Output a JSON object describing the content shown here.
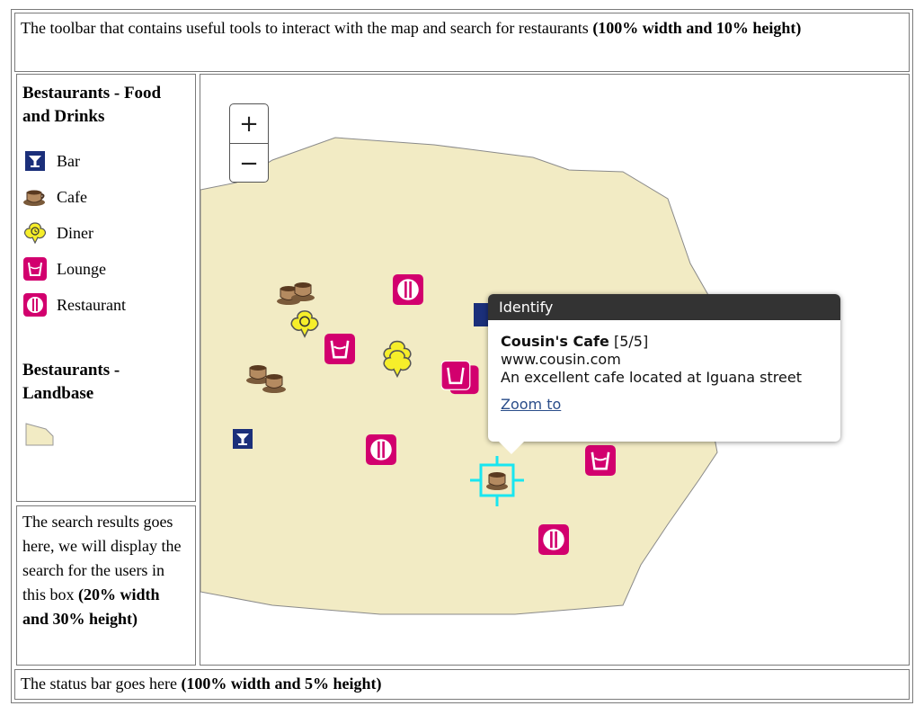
{
  "toolbar": {
    "text": "The toolbar that contains useful tools to interact with the map and search for restaurants ",
    "bold": "(100% width and 10% height)"
  },
  "legend": {
    "food_title": "Bestaurants - Food and Drinks",
    "items": [
      {
        "label": "Bar",
        "icon": "bar-icon"
      },
      {
        "label": "Cafe",
        "icon": "cafe-icon"
      },
      {
        "label": "Diner",
        "icon": "diner-icon"
      },
      {
        "label": "Lounge",
        "icon": "lounge-icon"
      },
      {
        "label": "Restaurant",
        "icon": "restaurant-icon"
      }
    ],
    "land_title": "Bestaurants - Landbase",
    "land_icon": "landbase-polygon-icon"
  },
  "results": {
    "text": "The search results goes here, we will display the search for the users in this box ",
    "bold": "(20% width and 30% height)"
  },
  "status": {
    "text": "The status bar goes here ",
    "bold": "(100% width and 5% height)"
  },
  "map": {
    "zoom_in": "+",
    "zoom_out": "−",
    "popup": {
      "title": "Identify",
      "name": "Cousin's Cafe",
      "count": "[5/5]",
      "url": "www.cousin.com",
      "description": "An excellent cafe located at Iguana street",
      "link": "Zoom to"
    }
  },
  "colors": {
    "land": "#f2ebc4",
    "restaurant": "#d2006e",
    "bar": "#1b2f7a",
    "diner": "#f6ee2a",
    "selection": "#19e6f0",
    "popup_header": "#333333"
  }
}
